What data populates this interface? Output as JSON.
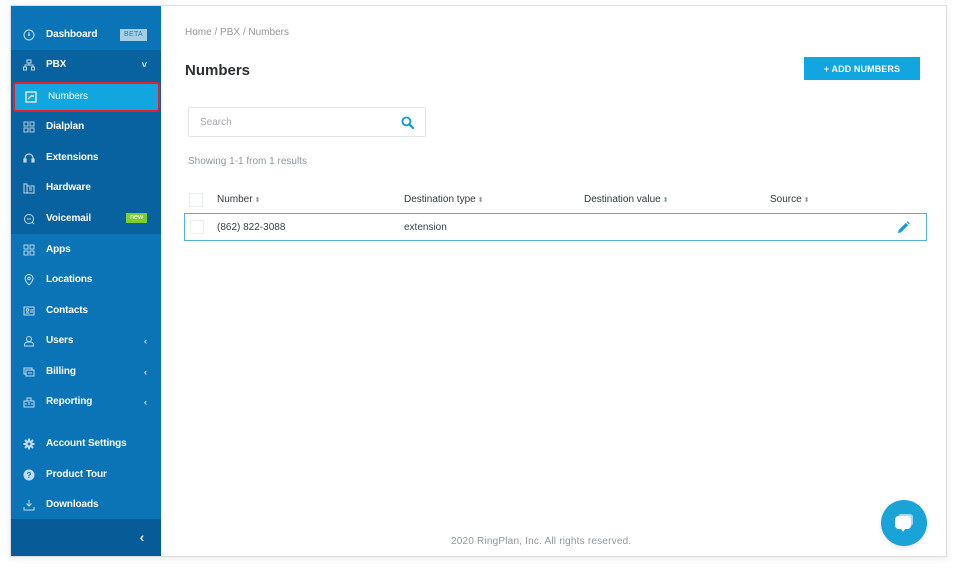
{
  "sidebar": {
    "items": [
      {
        "key": "dashboard",
        "label": "Dashboard",
        "icon": "dashboard-icon",
        "badge": "BETA"
      },
      {
        "key": "pbx",
        "label": "PBX",
        "icon": "pbx-network-icon",
        "chevron": "˅"
      },
      {
        "key": "numbers",
        "label": "Numbers",
        "icon": "numbers-icon",
        "active": true
      },
      {
        "key": "dialplan",
        "label": "Dialplan",
        "icon": "dialplan-icon"
      },
      {
        "key": "extensions",
        "label": "Extensions",
        "icon": "headset-icon"
      },
      {
        "key": "hardware",
        "label": "Hardware",
        "icon": "hardware-icon"
      },
      {
        "key": "voicemail",
        "label": "Voicemail",
        "icon": "voicemail-icon",
        "badge": "new"
      },
      {
        "key": "apps",
        "label": "Apps",
        "icon": "apps-icon"
      },
      {
        "key": "locations",
        "label": "Locations",
        "icon": "location-pin-icon"
      },
      {
        "key": "contacts",
        "label": "Contacts",
        "icon": "contacts-icon"
      },
      {
        "key": "users",
        "label": "Users",
        "icon": "user-icon",
        "chevron": "‹"
      },
      {
        "key": "billing",
        "label": "Billing",
        "icon": "billing-icon",
        "chevron": "‹"
      },
      {
        "key": "reporting",
        "label": "Reporting",
        "icon": "reporting-icon",
        "chevron": "‹"
      },
      {
        "key": "account-settings",
        "label": "Account Settings",
        "icon": "gear-icon"
      },
      {
        "key": "product-tour",
        "label": "Product Tour",
        "icon": "help-icon"
      },
      {
        "key": "downloads",
        "label": "Downloads",
        "icon": "download-icon"
      }
    ],
    "collapse_glyph": "‹"
  },
  "breadcrumb": [
    "Home",
    "PBX",
    "Numbers"
  ],
  "breadcrumb_separator": " / ",
  "page_title": "Numbers",
  "add_button_label": "+ ADD NUMBERS",
  "search": {
    "placeholder": "Search",
    "value": ""
  },
  "results_text": "Showing 1-1 from 1 results",
  "table": {
    "columns": [
      "Number",
      "Destination type",
      "Destination value",
      "Source"
    ],
    "sort_glyph": "⬍",
    "rows": [
      {
        "number": "(862) 822-3088",
        "destination_type": "extension",
        "destination_value": "",
        "source": ""
      }
    ]
  },
  "footer_text": "2020 RingPlan, Inc. All rights reserved.",
  "colors": {
    "sidebar_bg": "#0a74b7",
    "submenu_bg": "#0862a0",
    "accent": "#11a6df",
    "active_outline": "#e3232a",
    "new_badge": "#7ccf2e"
  }
}
